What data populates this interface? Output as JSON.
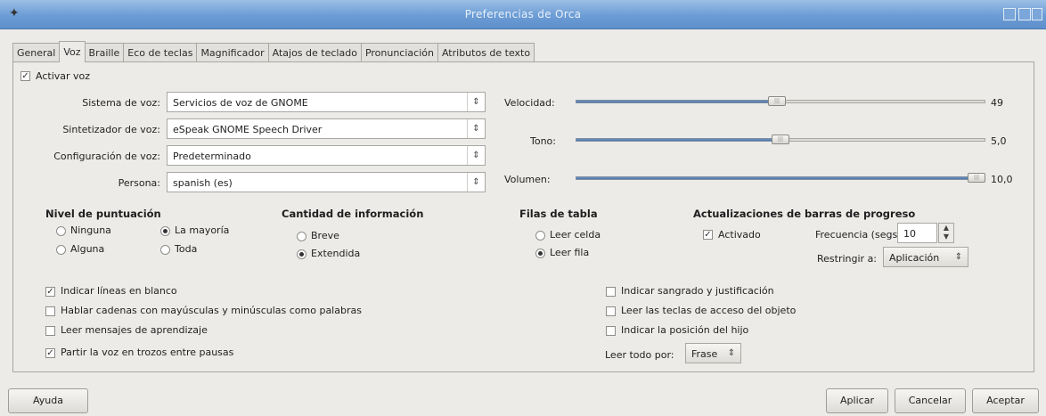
{
  "window": {
    "title": "Preferencias de Orca"
  },
  "tabs": [
    "General",
    "Voz",
    "Braille",
    "Eco de teclas",
    "Magnificador",
    "Atajos de teclado",
    "Pronunciación",
    "Atributos de texto"
  ],
  "enable_speech": {
    "label": "Activar voz",
    "checked": true
  },
  "fields": {
    "speech_system": {
      "label": "Sistema de voz:",
      "value": "Servicios de voz de GNOME"
    },
    "synthesizer": {
      "label": "Sintetizador de voz:",
      "value": "eSpeak GNOME Speech Driver"
    },
    "voice_settings": {
      "label": "Configuración de voz:",
      "value": "Predeterminado"
    },
    "person": {
      "label": "Persona:",
      "value": "spanish (es)"
    }
  },
  "sliders": {
    "rate": {
      "label": "Velocidad:",
      "value": "49",
      "level": 0.49
    },
    "pitch": {
      "label": "Tono:",
      "value": "5,0",
      "level": 0.5
    },
    "volume": {
      "label": "Volumen:",
      "value": "10,0",
      "level": 1.0
    }
  },
  "punctuation": {
    "heading": "Nivel de puntuación",
    "options": {
      "none": "Ninguna",
      "most": "La mayoría",
      "some": "Alguna",
      "all": "Toda"
    },
    "selected": "most"
  },
  "verbosity": {
    "heading": "Cantidad de información",
    "options": {
      "brief": "Breve",
      "extended": "Extendida"
    },
    "selected": "extended"
  },
  "table_rows": {
    "heading": "Filas de tabla",
    "options": {
      "cell": "Leer celda",
      "row": "Leer fila"
    },
    "selected": "row"
  },
  "progress": {
    "heading": "Actualizaciones de barras de progreso",
    "enabled_label": "Activado",
    "enabled": true,
    "frequency_label": "Frecuencia (segs):",
    "frequency_value": "10",
    "restrict_label": "Restringir a:",
    "restrict_value": "Aplicación"
  },
  "checkboxes_left": {
    "blank_lines": {
      "label": "Indicar líneas en blanco",
      "checked": true
    },
    "mixed_case": {
      "label": "Hablar cadenas con mayúsculas y minúsculas como palabras",
      "checked": false
    },
    "tutorial": {
      "label": "Leer mensajes de aprendizaje",
      "checked": false
    },
    "pauses": {
      "label": "Partir la voz en trozos entre pausas",
      "checked": true
    }
  },
  "checkboxes_right": {
    "indentation": {
      "label": "Indicar sangrado y justificación",
      "checked": false
    },
    "mnemonics": {
      "label": "Leer las teclas de acceso del objeto",
      "checked": false
    },
    "child_position": {
      "label": "Indicar la posición del hijo",
      "checked": false
    }
  },
  "say_all": {
    "label": "Leer todo por:",
    "value": "Frase"
  },
  "buttons": {
    "help": "Ayuda",
    "apply": "Aplicar",
    "cancel": "Cancelar",
    "accept": "Aceptar"
  }
}
